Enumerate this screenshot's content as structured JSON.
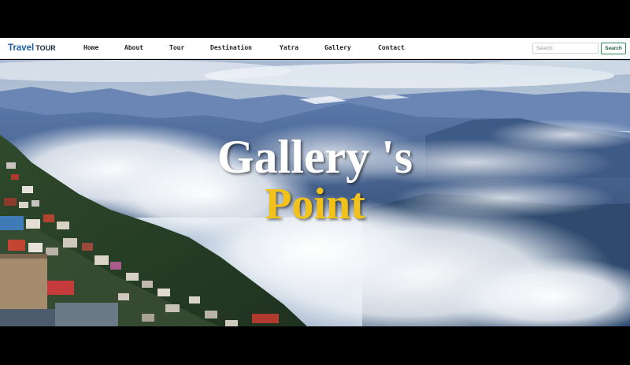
{
  "navbar": {
    "brand_primary": "Travel",
    "brand_secondary": "TOUR",
    "links": [
      "Home",
      "About",
      "Tour",
      "Destination",
      "Yatra",
      "Gallery",
      "Contact"
    ],
    "search_placeholder": "Search",
    "search_button": "Search"
  },
  "hero": {
    "title": "Gallery 's",
    "subtitle": "Point",
    "title_color": "#ffffff",
    "subtitle_color": "#f2c21a"
  },
  "colors": {
    "brand_blue": "#1a5fa8",
    "search_border": "#2e8b57"
  }
}
